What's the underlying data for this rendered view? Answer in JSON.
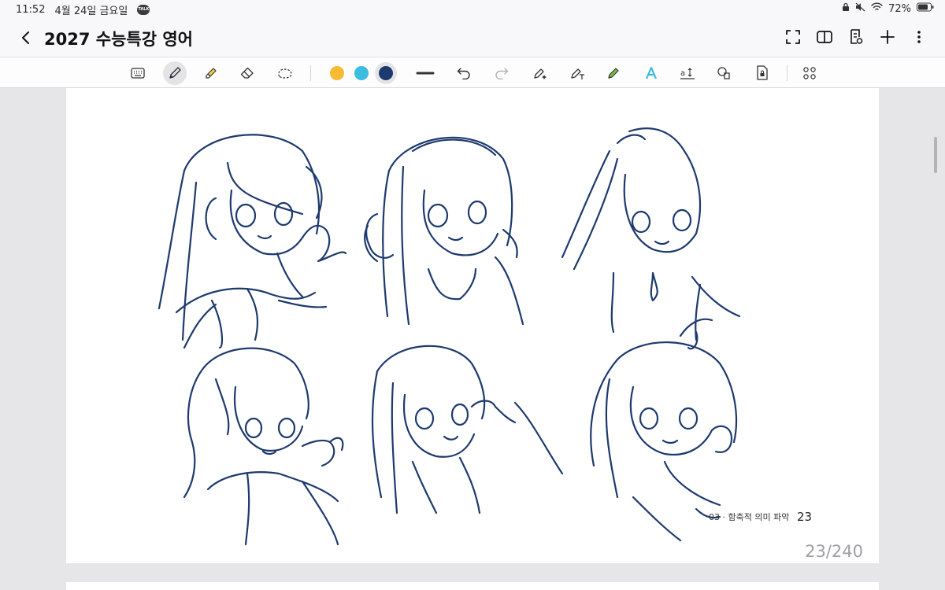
{
  "status_bar": {
    "time": "11:52",
    "date": "4월 24일 금요일",
    "talk_badge": "TALK",
    "battery": "72%"
  },
  "header": {
    "title": "2027 수능특강 영어",
    "icons": [
      "back-arrow-icon",
      "fullscreen-icon",
      "book-view-icon",
      "page-settings-icon",
      "plus-icon",
      "more-vertical-icon"
    ]
  },
  "toolbar": {
    "tools": [
      "keyboard",
      "pen",
      "highlighter",
      "eraser",
      "lasso",
      "color-yellow",
      "color-cyan",
      "color-navy",
      "line-thickness",
      "undo",
      "redo",
      "pen-sparkle",
      "pen-text",
      "color-marker",
      "text-style",
      "text-size",
      "shapes",
      "lock-page",
      "apps"
    ],
    "colors": {
      "yellow": "#f6bb33",
      "cyan": "#3cbde0",
      "navy": "#1d3a6e"
    },
    "active_tool": "pen",
    "selected_color": "navy"
  },
  "page": {
    "footer_text": "03 · 함축적 의미 파악",
    "page_number": "23",
    "page_count": "23/240"
  },
  "accent_color": "#1d3a6e"
}
